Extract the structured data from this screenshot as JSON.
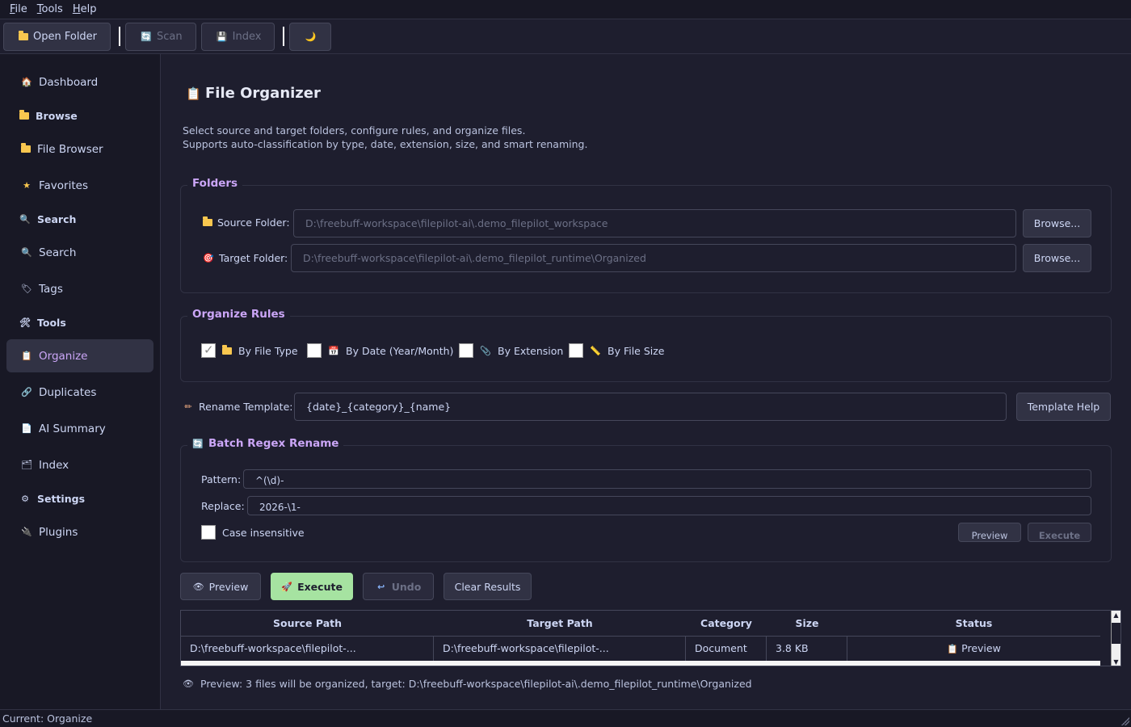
{
  "menu": {
    "file": {
      "u": "F",
      "rest": "ile"
    },
    "tools": {
      "u": "T",
      "rest": "ools"
    },
    "help": {
      "u": "H",
      "rest": "elp"
    }
  },
  "toolbar": {
    "open_folder": "Open Folder",
    "scan": "Scan",
    "index": "Index",
    "theme_icon": "🌙"
  },
  "sidebar": {
    "dashboard": "Dashboard",
    "browse_section": "Browse",
    "file_browser": "File Browser",
    "favorites": "Favorites",
    "search_section": "Search",
    "search": "Search",
    "tags": "Tags",
    "tools_section": "Tools",
    "organize": "Organize",
    "duplicates": "Duplicates",
    "ai_summary": "AI Summary",
    "index": "Index",
    "settings_section": "Settings",
    "plugins": "Plugins"
  },
  "page": {
    "title": "File Organizer",
    "desc_line1": "Select source and target folders, configure rules, and organize files.",
    "desc_line2": "Supports auto-classification by type, date, extension, size, and smart renaming."
  },
  "folders": {
    "title": "Folders",
    "source_label": "Source Folder:",
    "source_value": "D:\\freebuff-workspace\\filepilot-ai\\.demo_filepilot_workspace",
    "target_label": "Target Folder:",
    "target_value": "D:\\freebuff-workspace\\filepilot-ai\\.demo_filepilot_runtime\\Organized",
    "browse_label": "Browse..."
  },
  "rules": {
    "title": "Organize Rules",
    "by_type": "By File Type",
    "by_type_checked": true,
    "by_date": "By Date (Year/Month)",
    "by_date_checked": false,
    "by_ext": "By Extension",
    "by_ext_checked": false,
    "by_size": "By File Size",
    "by_size_checked": false
  },
  "rename": {
    "label": "Rename Template:",
    "value": "{date}_{category}_{name}",
    "help": "Template Help"
  },
  "regex": {
    "title": "Batch Regex Rename",
    "pattern_label": "Pattern:",
    "pattern_value": "^(\\d)-",
    "replace_label": "Replace:",
    "replace_value": "2026-\\1-",
    "case_label": "Case insensitive",
    "preview": "Preview",
    "execute": "Execute"
  },
  "actions": {
    "preview": "Preview",
    "execute": "Execute",
    "undo": "Undo",
    "clear": "Clear Results"
  },
  "table": {
    "headers": [
      "Source Path",
      "Target Path",
      "Category",
      "Size",
      "Status"
    ],
    "rows": [
      [
        "D:\\freebuff-workspace\\filepilot-...",
        "D:\\freebuff-workspace\\filepilot-...",
        "Document",
        "3.8 KB",
        "Preview"
      ]
    ]
  },
  "preview_msg": "Preview: 3 files will be organized, target: D:\\freebuff-workspace\\filepilot-ai\\.demo_filepilot_runtime\\Organized",
  "status": "Current: Organize"
}
